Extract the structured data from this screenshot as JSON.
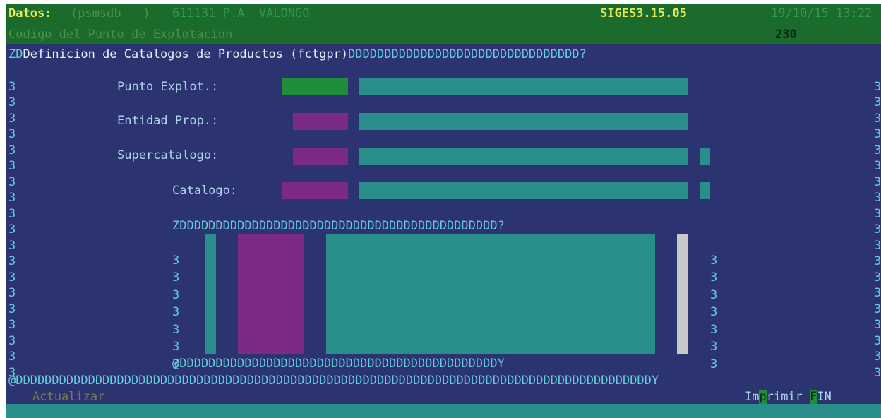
{
  "header": {
    "datos_label": "Datos:",
    "db": "(psmsdb   )",
    "site": "611131 P.A. VALONGO",
    "version": "SIGES3.15.05",
    "datetime": "19/10/15 13:22",
    "field_hint": "Codigo del Punto de Explotacion",
    "field_value": "230"
  },
  "screen": {
    "title_prefix": "ZD",
    "title": "Definicion de Catalogos de Productos (fctgpr)",
    "title_fill": "DDDDDDDDDDDDDDDDDDDDDDDDDDDDDDDD?",
    "border_char": "3",
    "bottom_border": "@DDDDDDDDDDDDDDDDDDDDDDDDDDDDDDDDDDDDDDDDDDDDDDDDDDDDDDDDDDDDDDDDDDDDDDDDDDDDDDDDDDDDDDDDY"
  },
  "form": {
    "punto_label": "Punto Explot.:",
    "entidad_label": "Entidad Prop.:",
    "super_label": "Supercatalogo:",
    "catalogo_label": "Catalogo:"
  },
  "list": {
    "top": "ZDDDDDDDDDDDDDDDDDDDDDDDDDDDDDDDDDDDDDDDDDDDD?",
    "bottom": "@DDDDDDDDDDDDDDDDDDDDDDDDDDDDDDDDDDDDDDDDDDDDY",
    "side_char": "3"
  },
  "footer": {
    "actualizar": "Actualizar",
    "imprimir_pre": "Im",
    "imprimir_hot": "p",
    "imprimir_post": "rimir",
    "fin_hot": "F",
    "fin_rest": "IN"
  },
  "colors": {
    "header_bg": "#1b6b2d",
    "screen_bg": "#2b3370",
    "field_teal": "#2a8f8a",
    "field_magenta": "#7d2a86",
    "field_green": "#1f8d3a",
    "scrollbar": "#c8c8c8"
  }
}
